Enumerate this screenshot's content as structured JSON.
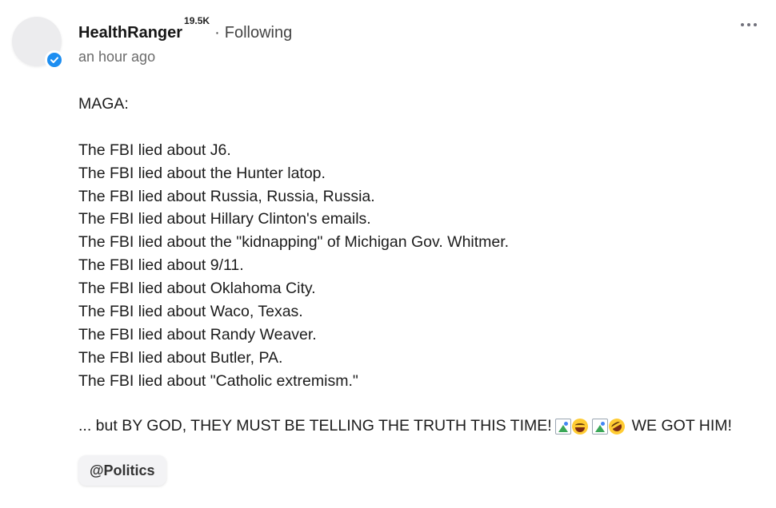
{
  "post": {
    "author": "HealthRanger",
    "followers": "19.5K",
    "separator": "·",
    "follow_state": "Following",
    "timestamp": "an hour ago",
    "lines": [
      "MAGA:",
      "",
      "The FBI lied about J6.",
      "The FBI lied about the Hunter latop.",
      "The FBI lied about Russia, Russia, Russia.",
      "The FBI lied about Hillary Clinton's emails.",
      "The FBI lied about the \"kidnapping\" of Michigan Gov. Whitmer.",
      "The FBI lied about 9/11.",
      "The FBI lied about Oklahoma City.",
      "The FBI lied about Waco, Texas.",
      "The FBI lied about Randy Weaver.",
      "The FBI lied about Butler, PA.",
      "The FBI lied about \"Catholic extremism.\""
    ],
    "closing": "... but BY GOD, THEY MUST BE TELLING THE TRUTH THIS TIME!",
    "closing_icons": [
      "broken-image-icon",
      "laughing-emoji-icon",
      "broken-image-icon",
      "rofl-emoji-icon"
    ],
    "closing_tail": "WE GOT HIM!",
    "tag": "@Politics"
  },
  "colors": {
    "verified_badge": "#1d8ef1",
    "tag_background": "#f3f3f5"
  }
}
